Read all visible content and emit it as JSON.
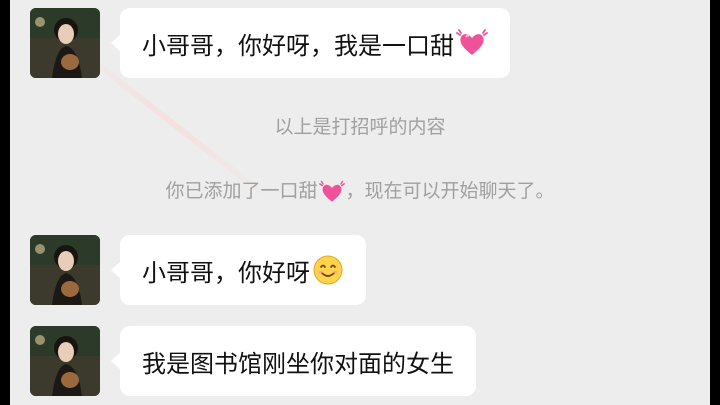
{
  "messages": [
    {
      "text": "小哥哥，你好呀，我是一口甜",
      "emoji": "sparkling-heart-icon"
    },
    {
      "text": "小哥哥，你好呀",
      "emoji": "smiling-face-icon"
    },
    {
      "text": "我是图书馆刚坐你对面的女生",
      "emoji": ""
    }
  ],
  "system": {
    "greeting_note": "以上是打招呼的内容",
    "added_prefix": "你已添加了一口甜",
    "added_suffix": "，现在可以开始聊天了。"
  },
  "colors": {
    "background": "#ededed",
    "bubble": "#ffffff",
    "system_text": "#a0a0a0",
    "heart": "#f0529a"
  }
}
